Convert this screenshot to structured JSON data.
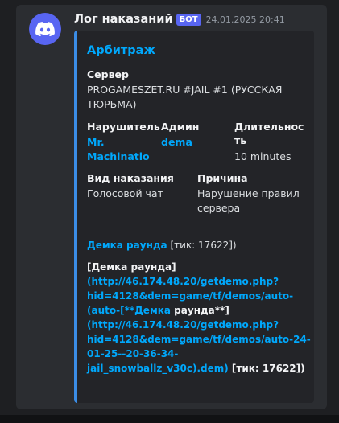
{
  "message": {
    "author": "Лог наказаний",
    "bot_tag": "БОТ",
    "timestamp": "24.01.2025 20:41",
    "avatar_icon": "discord-logo-icon",
    "accent_color": "#3b8de6"
  },
  "embed": {
    "title": "Арбитраж",
    "server": {
      "name": "Сервер",
      "value": "PROGAMESZET.RU #JAIL #1 (РУССКАЯ ТЮРЬМА)"
    },
    "violator": {
      "name": "Нарушитель",
      "value_line1": "Mr.",
      "value_line2": "Machinatio"
    },
    "admin": {
      "name": "Админ",
      "value": "dema"
    },
    "duration": {
      "name_line1": "Длительнос",
      "name_line2": "ть",
      "value": "10 minutes"
    },
    "punishment": {
      "name": "Вид наказания",
      "value": "Голосовой чат"
    },
    "reason": {
      "name": "Причина",
      "value_line1": "Нарушение правил",
      "value_line2": "сервера"
    },
    "demo_line": {
      "link": "Демка раунда",
      "text": " [тик: 17622])"
    },
    "description": {
      "l1": "[Демка раунда]",
      "l2": "(http://46.174.48.20/getdemo.php?",
      "l3": "hid=4128&dem=game/tf/demos/auto-",
      "l4_link": "(auto-[**Демка",
      "l4_text": " раунда**]",
      "l5": "(http://46.174.48.20/getdemo.php?",
      "l6": "hid=4128&dem=game/tf/demos/auto-24-",
      "l7": "01-25--20-36-34-",
      "l8_link": "jail_snowballz_v30c).dem)",
      "l8_text": " [тик: 17622])"
    }
  }
}
